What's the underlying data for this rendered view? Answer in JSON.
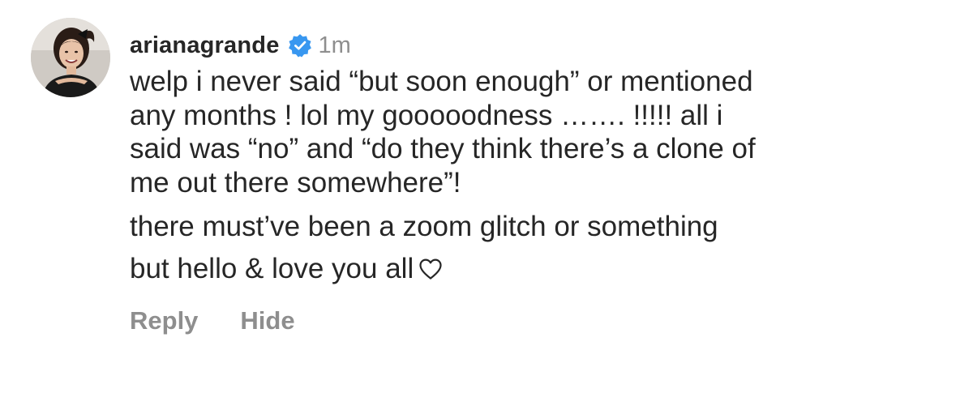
{
  "comment": {
    "username": "arianagrande",
    "verified_icon": "verified-badge-icon",
    "timestamp": "1m",
    "paragraph1_lines": [
      "welp i never said “but soon enough” or mentioned",
      "any months ! lol my gooooodness ……. !!!!! all i",
      "said was “no” and “do they think there’s a clone of",
      "me out there somewhere”!"
    ],
    "paragraph2_lines": [
      "there must’ve been a zoom glitch or something",
      "but hello & love you all"
    ],
    "end_icon": "heart-outline-icon",
    "avatar_icon": "profile-photo-avatar"
  },
  "actions": {
    "reply_label": "Reply",
    "hide_label": "Hide"
  },
  "colors": {
    "text": "#262626",
    "secondary": "#8e8e8e",
    "verified_blue": "#3897f0"
  }
}
